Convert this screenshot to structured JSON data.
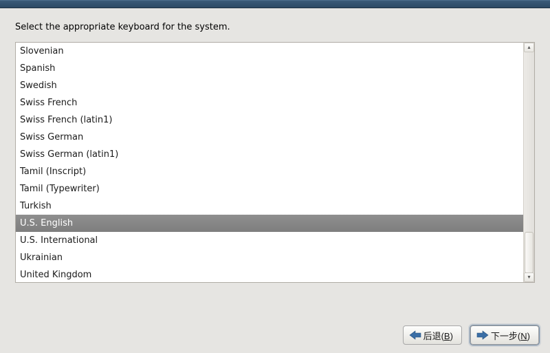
{
  "prompt": "Select the appropriate keyboard for the system.",
  "selected_index": 10,
  "keyboards": [
    "Slovenian",
    "Spanish",
    "Swedish",
    "Swiss French",
    "Swiss French (latin1)",
    "Swiss German",
    "Swiss German (latin1)",
    "Tamil (Inscript)",
    "Tamil (Typewriter)",
    "Turkish",
    "U.S. English",
    "U.S. International",
    "Ukrainian",
    "United Kingdom"
  ],
  "buttons": {
    "back_prefix": "后退(",
    "back_accel": "B",
    "back_suffix": ")",
    "next_prefix": "下一步(",
    "next_accel": "N",
    "next_suffix": ")"
  },
  "colors": {
    "arrow": "#3a6ea5"
  }
}
